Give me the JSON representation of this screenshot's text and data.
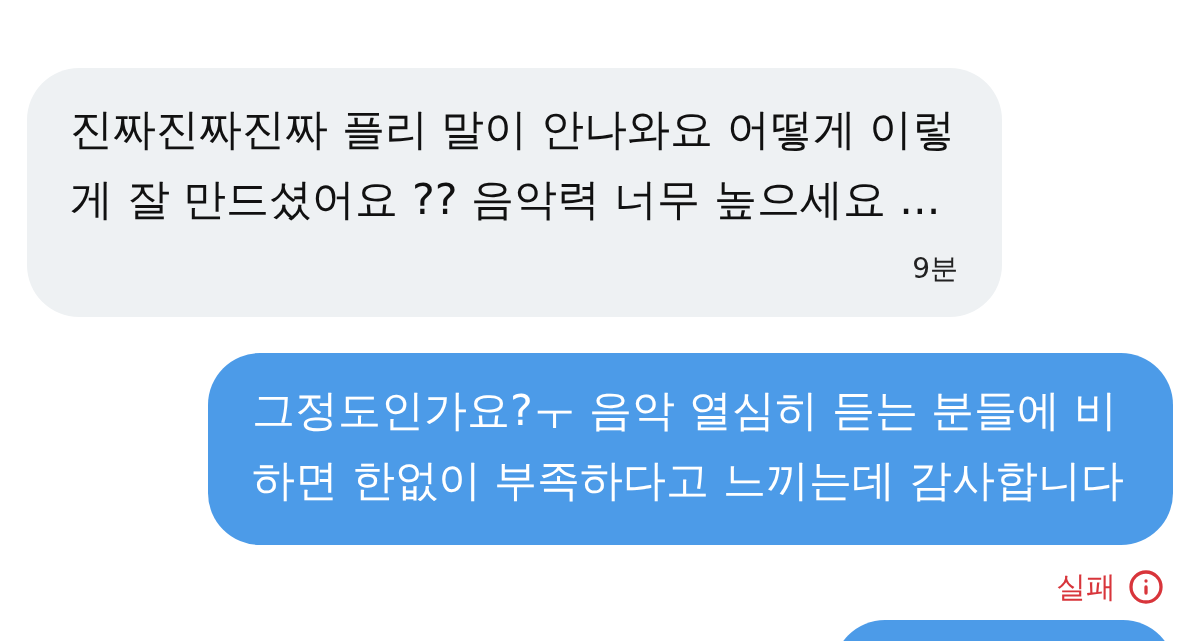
{
  "messages": [
    {
      "kind": "received",
      "text": "진짜진짜진짜 플리 말이 안나와요 어떻게 이렇게 잘 만드셨어요 ?? 음악력 너무 높으세요 ...",
      "time": "9분"
    },
    {
      "kind": "sent",
      "text": "그정도인가요?ㅜ 음악 열심히 듣는 분들에 비하면 한없이 부족하다고 느끼는데 감사합니다",
      "status": "실패",
      "failed": true
    },
    {
      "kind": "sent"
    }
  ]
}
